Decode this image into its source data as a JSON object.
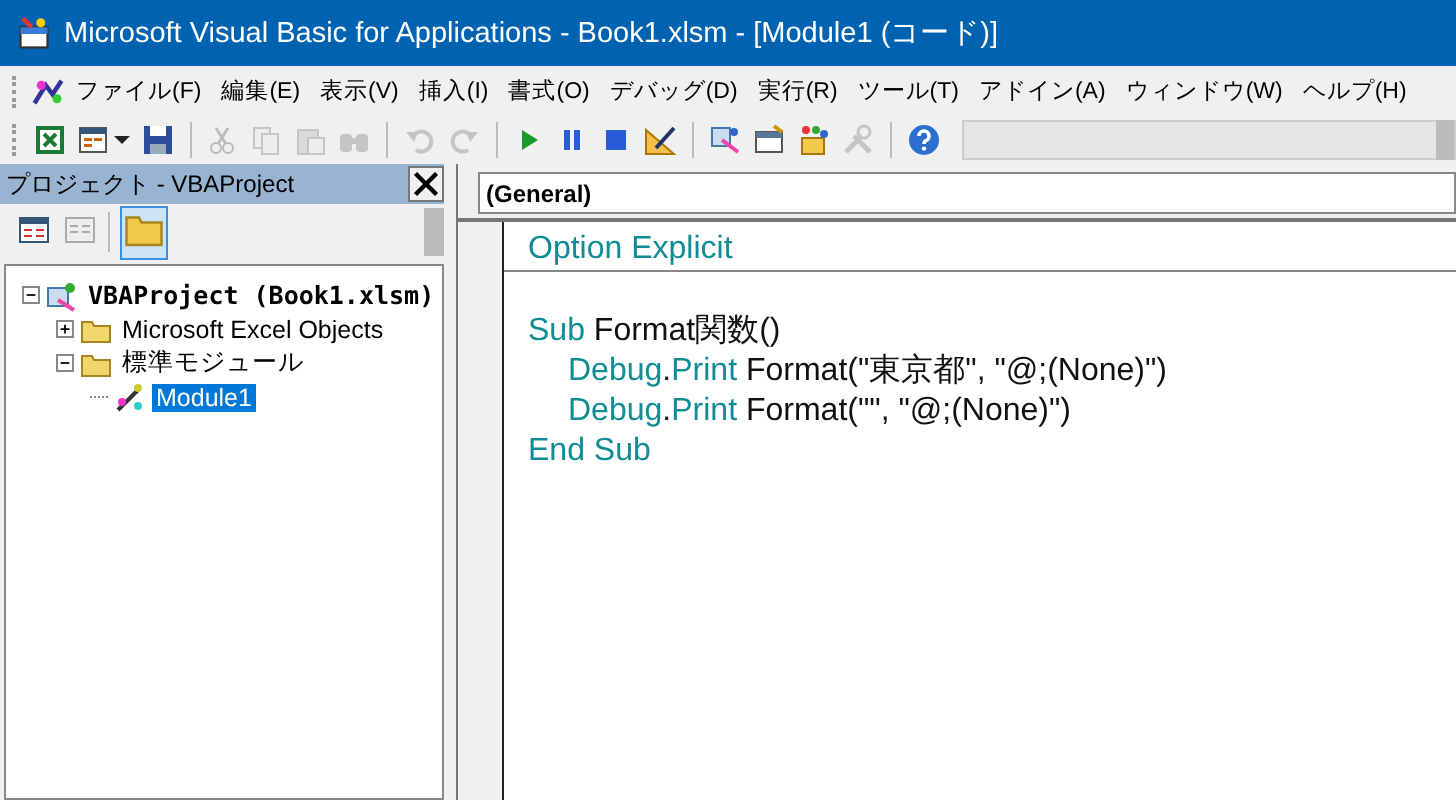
{
  "window": {
    "title": "Microsoft Visual Basic for Applications - Book1.xlsm - [Module1 (コード)]"
  },
  "menu": [
    "ファイル(F)",
    "編集(E)",
    "表示(V)",
    "挿入(I)",
    "書式(O)",
    "デバッグ(D)",
    "実行(R)",
    "ツール(T)",
    "アドイン(A)",
    "ウィンドウ(W)",
    "ヘルプ(H)"
  ],
  "toolbar": [
    {
      "kind": "excel",
      "disabled": false
    },
    {
      "kind": "form",
      "disabled": false
    },
    {
      "kind": "save",
      "disabled": false
    },
    {
      "kind": "sep",
      "disabled": false
    },
    {
      "kind": "cut",
      "disabled": true
    },
    {
      "kind": "copy",
      "disabled": true
    },
    {
      "kind": "paste",
      "disabled": true
    },
    {
      "kind": "find",
      "disabled": true
    },
    {
      "kind": "sep",
      "disabled": false
    },
    {
      "kind": "undo",
      "disabled": true
    },
    {
      "kind": "redo",
      "disabled": true
    },
    {
      "kind": "sep",
      "disabled": false
    },
    {
      "kind": "run",
      "disabled": false
    },
    {
      "kind": "pause",
      "disabled": false
    },
    {
      "kind": "stop",
      "disabled": false
    },
    {
      "kind": "design",
      "disabled": false
    },
    {
      "kind": "sep",
      "disabled": false
    },
    {
      "kind": "project",
      "disabled": false
    },
    {
      "kind": "properties",
      "disabled": false
    },
    {
      "kind": "objects",
      "disabled": false
    },
    {
      "kind": "tools",
      "disabled": true
    },
    {
      "kind": "sep",
      "disabled": false
    },
    {
      "kind": "help",
      "disabled": false
    }
  ],
  "project_pane": {
    "title": "プロジェクト - VBAProject",
    "tree": [
      {
        "label": "VBAProject (Book1.xlsm)",
        "kind": "project",
        "expanded": true,
        "selected": false,
        "children": [
          {
            "label": "Microsoft Excel Objects",
            "kind": "folder",
            "expanded": false,
            "selected": false
          },
          {
            "label": "標準モジュール",
            "kind": "folder",
            "expanded": true,
            "selected": false,
            "children": [
              {
                "label": "Module1",
                "kind": "module",
                "selected": true
              }
            ]
          }
        ]
      }
    ]
  },
  "editor": {
    "object_box": "(General)",
    "lines": [
      {
        "kind": "code",
        "divider": true,
        "tokens": [
          {
            "text": "Option Explicit",
            "kind": "keyword"
          }
        ]
      },
      {
        "kind": "blank"
      },
      {
        "kind": "code",
        "tokens": [
          {
            "text": "Sub",
            "kind": "keyword"
          },
          {
            "text": " Format関数()",
            "kind": "plain"
          }
        ],
        "children": [
          {
            "kind": "code",
            "tokens": [
              {
                "text": "Debug",
                "kind": "keyword"
              },
              {
                "text": ".Print",
                "kind": "member"
              },
              {
                "text": " Format(\"東京都\", \"@;(None)\")",
                "kind": "plain"
              }
            ]
          },
          {
            "kind": "code",
            "tokens": [
              {
                "text": "Debug",
                "kind": "keyword"
              },
              {
                "text": ".Print",
                "kind": "member"
              },
              {
                "text": " Format(\"\", \"@;(None)\")",
                "kind": "plain"
              }
            ]
          }
        ]
      },
      {
        "kind": "code",
        "tokens": [
          {
            "text": "End Sub",
            "kind": "keyword"
          }
        ]
      }
    ]
  }
}
